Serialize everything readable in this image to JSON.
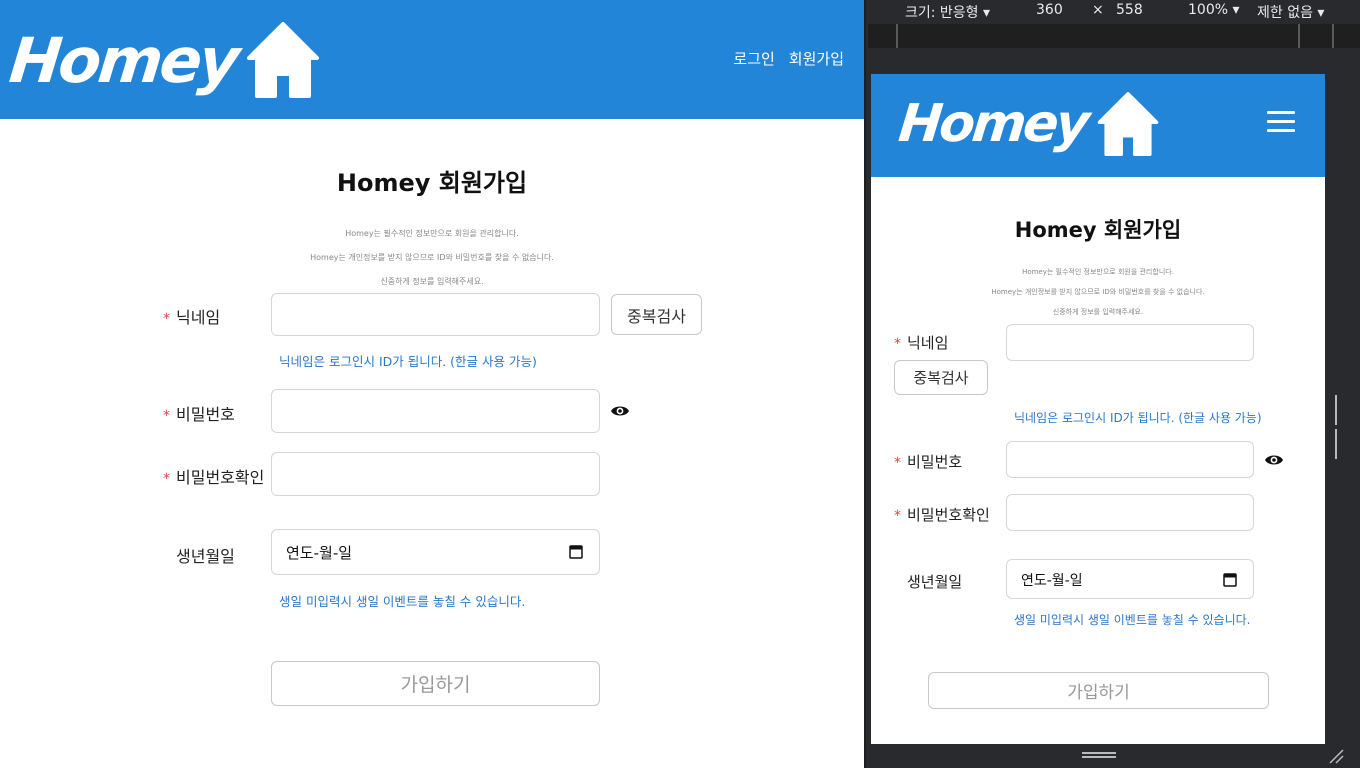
{
  "desktop": {
    "logo_text": "Homey",
    "nav": {
      "login": "로그인",
      "signup": "회원가입"
    },
    "title": "Homey 회원가입",
    "notes": [
      "Homey는 필수적인 정보만으로 회원을 관리합니다.",
      "Homey는 개인정보를 받지 않으므로 ID와 비밀번호를 찾을 수 없습니다.",
      "신중하게 정보를 입력해주세요."
    ],
    "form": {
      "nickname_label": "닉네임",
      "duplicate_check": "중복검사",
      "nickname_hint": "닉네임은 로그인시 ID가 됩니다. (한글 사용 가능)",
      "password_label": "비밀번호",
      "password_confirm_label": "비밀번호확인",
      "birthday_label": "생년월일",
      "birthday_value": "연도-월-일",
      "birthday_hint": "생일 미입력시 생일 이벤트를 놓칠 수 있습니다.",
      "required_mark": "*",
      "submit": "가입하기"
    }
  },
  "devtools": {
    "dimensions_label": "크기: 반응형",
    "width": "360",
    "times": "×",
    "height": "558",
    "zoom": "100%",
    "throttle": "제한 없음"
  },
  "colors": {
    "brand": "#2385d8",
    "hint": "#2a78c9",
    "required": "#e04444"
  }
}
